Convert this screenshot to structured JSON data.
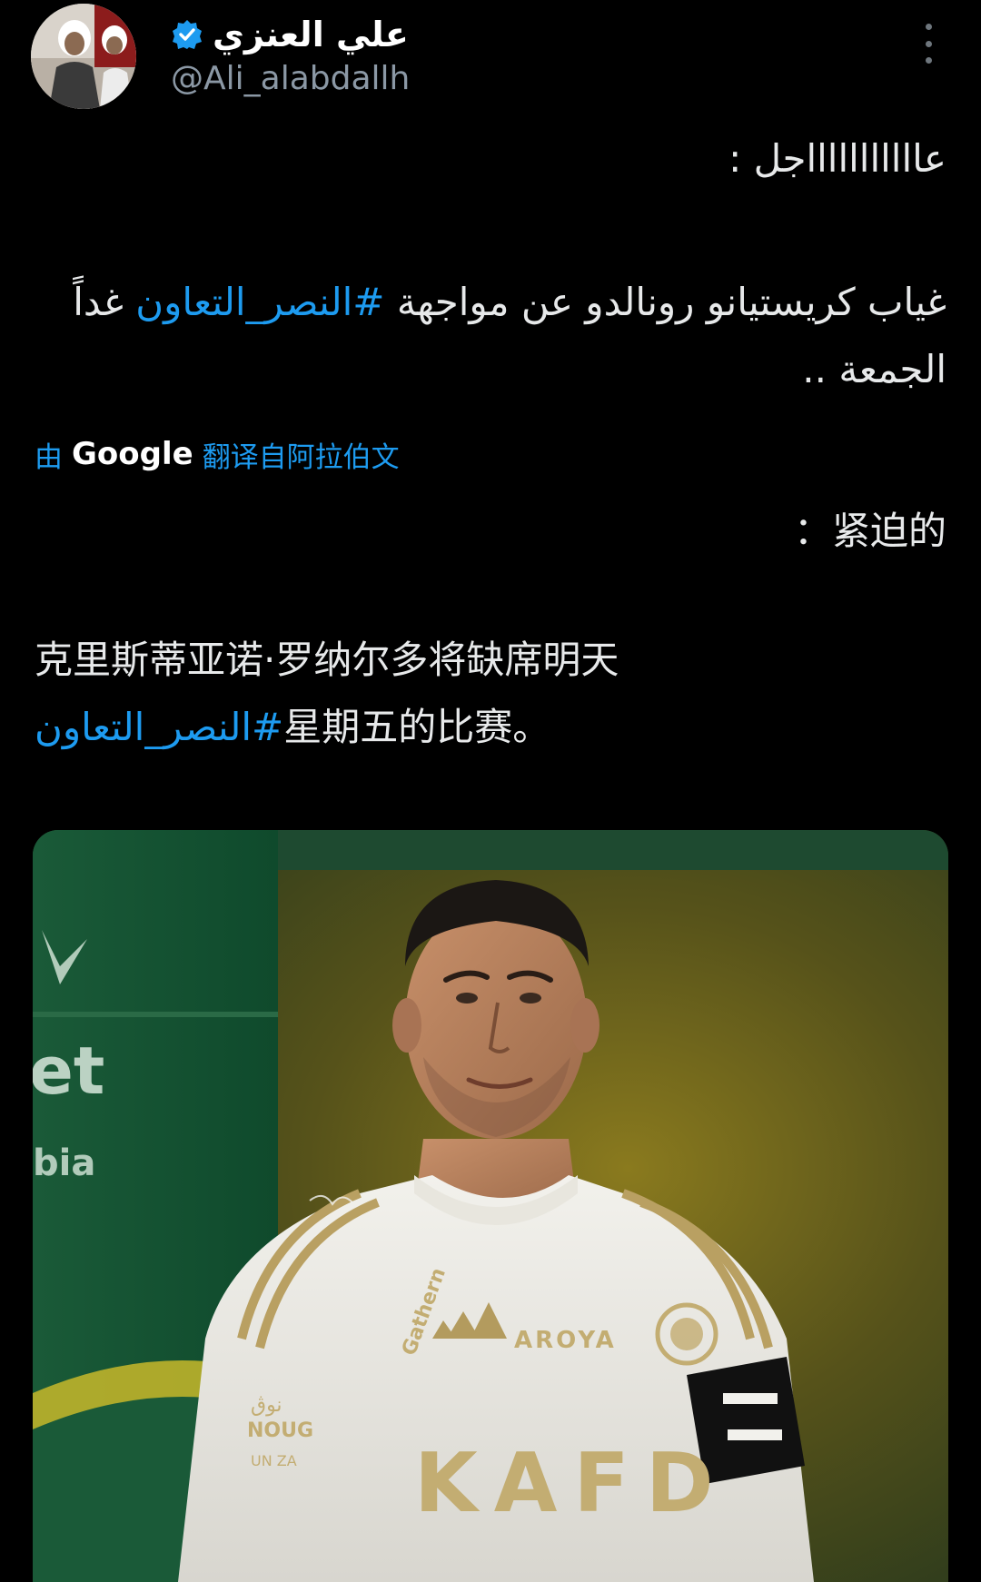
{
  "author": {
    "name": "علي العنزي",
    "handle": "@Ali_alabdallh",
    "verified": true,
    "verified_color": "#1d9bf0"
  },
  "tweet": {
    "line1": "عاااااااااااجل :",
    "body_text": "غياب كريستيانو رونالدو عن مواجهة ",
    "hashtag": "#النصر_التعاون",
    "body_text_2": " غداً الجمعة .."
  },
  "translation": {
    "prefix": "由",
    "engine": "Google",
    "suffix": "翻译自阿拉伯文",
    "line1": "：紧迫的",
    "body_text": "克里斯蒂亚诺·罗纳尔多将缺席明天",
    "hashtag": "#النصر_التعاون",
    "body_text_2": "星期五的比赛。"
  },
  "media": {
    "image_description_icon": "photo-icon",
    "jersey_sponsor": "KAFD",
    "jersey_top_sponsor": "AROYA",
    "sleeve_text": "Gathern",
    "left_sleeve_patch_1": "نوڨ",
    "left_sleeve_patch_2": "NOUG",
    "left_sleeve_patch_3": "UN ZA",
    "background_fragment_1": "et",
    "background_fragment_2": "bia"
  },
  "colors": {
    "background": "#000000",
    "text": "#e7e9ea",
    "secondary": "#8b98a5",
    "link": "#1d9bf0"
  }
}
